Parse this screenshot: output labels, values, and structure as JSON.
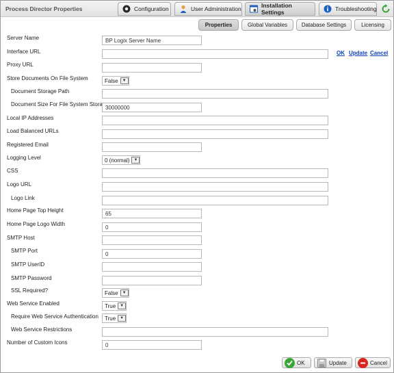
{
  "app": {
    "title": "Process Director Properties"
  },
  "main_tabs": [
    {
      "label": "Configuration"
    },
    {
      "label": "User Administration"
    },
    {
      "label": "Installation Settings"
    },
    {
      "label": "Troubleshooting"
    }
  ],
  "sub_tabs": [
    {
      "label": "Properties"
    },
    {
      "label": "Global Variables"
    },
    {
      "label": "Database Settings"
    },
    {
      "label": "Licensing"
    }
  ],
  "links": {
    "ok": "OK",
    "update": "Update",
    "cancel": "Cancel"
  },
  "fields": {
    "server_name": {
      "label": "Server Name",
      "value": "BP Logix Server Name"
    },
    "interface_url": {
      "label": "Interface URL",
      "value": ""
    },
    "proxy_url": {
      "label": "Proxy URL",
      "value": ""
    },
    "store_docs": {
      "label": "Store Documents On File System",
      "value": "False"
    },
    "doc_storage_path": {
      "label": "Document Storage Path",
      "value": ""
    },
    "doc_size": {
      "label": "Document Size For File System Storage",
      "value": "30000000"
    },
    "local_ip": {
      "label": "Local IP Addresses",
      "value": ""
    },
    "load_balanced": {
      "label": "Load Balanced URLs",
      "value": ""
    },
    "registered_email": {
      "label": "Registered Email",
      "value": ""
    },
    "logging_level": {
      "label": "Logging Level",
      "value": "0 (normal)"
    },
    "css": {
      "label": "CSS",
      "value": ""
    },
    "logo_url": {
      "label": "Logo URL",
      "value": ""
    },
    "logo_link": {
      "label": "Logo Link",
      "value": ""
    },
    "home_top_height": {
      "label": "Home Page Top Height",
      "value": "65"
    },
    "home_logo_width": {
      "label": "Home Page Logo Width",
      "value": "0"
    },
    "smtp_host": {
      "label": "SMTP Host",
      "value": ""
    },
    "smtp_port": {
      "label": "SMTP Port",
      "value": "0"
    },
    "smtp_userid": {
      "label": "SMTP UserID",
      "value": ""
    },
    "smtp_password": {
      "label": "SMTP Password",
      "value": ""
    },
    "ssl_required": {
      "label": "SSL Required?",
      "value": "False"
    },
    "ws_enabled": {
      "label": "Web Service Enabled",
      "value": "True"
    },
    "ws_auth": {
      "label": "Require Web Service Authentication",
      "value": "True"
    },
    "ws_restrictions": {
      "label": "Web Service Restrictions",
      "value": ""
    },
    "custom_icons": {
      "label": "Number of Custom Icons",
      "value": "0"
    }
  },
  "buttons": {
    "ok": "OK",
    "update": "Update",
    "cancel": "Cancel"
  },
  "colors": {
    "link": "#0b3fb5",
    "ok_green": "#3aa636",
    "cancel_red": "#d9261c",
    "accent_blue": "#1f5fbf"
  },
  "icons": {
    "configuration": "gear-icon",
    "user_admin": "user-icon",
    "installation": "settings-window-icon",
    "troubleshooting": "info-icon",
    "refresh": "refresh-icon",
    "ok": "checkmark-icon",
    "update": "floppy-disk-icon",
    "cancel": "cancel-icon"
  }
}
